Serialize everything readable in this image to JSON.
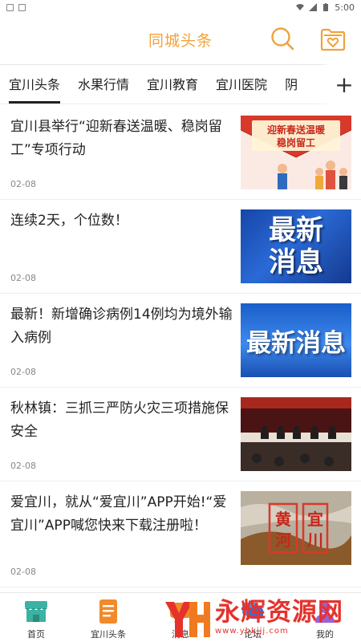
{
  "status": {
    "time": "5:00"
  },
  "header": {
    "title": "同城头条"
  },
  "tabs": [
    {
      "label": "宜川头条",
      "active": true
    },
    {
      "label": "水果行情",
      "active": false
    },
    {
      "label": "宜川教育",
      "active": false
    },
    {
      "label": "宜川医院",
      "active": false
    },
    {
      "label": "阴",
      "active": false
    }
  ],
  "tabs_add_label": "+",
  "feed": [
    {
      "title": "宜川县举行“迎新春送温暖、稳岗留工”专项行动",
      "date": "02-08",
      "thumb_text_1": "迎新春送温暖",
      "thumb_text_2": "稳岗留工"
    },
    {
      "title": "连续2天，个位数！",
      "date": "02-08",
      "thumb_text_1": "最新",
      "thumb_text_2": "消息"
    },
    {
      "title": "最新！新增确诊病例14例均为境外输入病例",
      "date": "02-08",
      "thumb_text_1": "最新消息"
    },
    {
      "title": "秋林镇：三抓三严防火灾三项措施保安全",
      "date": "02-08"
    },
    {
      "title": "爱宜川，就从“爱宜川”APP开始!“爱宜川”APP喊您快来下载注册啦！",
      "date": "02-08",
      "thumb_text_1": "黄",
      "thumb_text_2": "河",
      "thumb_text_3": "宜",
      "thumb_text_4": "川"
    }
  ],
  "tabbar": [
    {
      "label": "首页",
      "icon": "shop-icon"
    },
    {
      "label": "宜川头条",
      "icon": "document-icon"
    },
    {
      "label": "消息",
      "icon": "message-icon"
    },
    {
      "label": "论坛",
      "icon": "forum-icon"
    },
    {
      "label": "我的",
      "icon": "profile-icon"
    }
  ],
  "watermark": {
    "brand": "永辉资源网",
    "url": "www.yhkjjj.com"
  },
  "colors": {
    "accent": "#f0a23a",
    "tab_orange": "#f08a2a",
    "tab_teal": "#3bb3a3"
  }
}
